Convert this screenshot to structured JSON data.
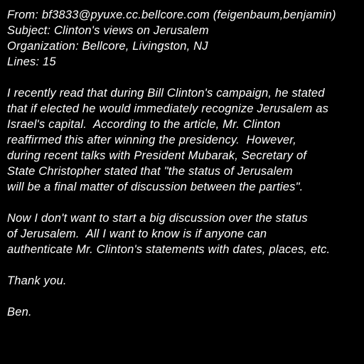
{
  "header": {
    "from": "From: bf3833@pyuxe.cc.bellcore.com (feigenbaum,benjamin)",
    "subject": "Subject: Clinton's views on Jerusalem",
    "organization": "Organization: Bellcore, Livingston, NJ",
    "lines": "Lines: 15"
  },
  "body": {
    "paragraph1": [
      "I recently read that during Bill Clinton's campaign, he stated",
      "that if elected he would immediately recognize Jerusalem as",
      "Israel's capital.  According to the article, Mr. Clinton",
      "reaffirmed this after winning the presidency.  However,",
      "during recent talks with President Mubarak, Secretary of",
      "State Christopher stated that \"the status of Jerusalem",
      "will be a final matter of discussion between the parties\"."
    ],
    "paragraph2": [
      "Now I don't want to start a big discussion over the status",
      "of Jerusalem.  All I want to know is if anyone can",
      "authenticate Mr. Clinton's statements with dates, places, etc."
    ],
    "closing": "Thank you.",
    "signature": "Ben."
  },
  "colors": {
    "background": "#000000",
    "text": "#ffffff"
  }
}
